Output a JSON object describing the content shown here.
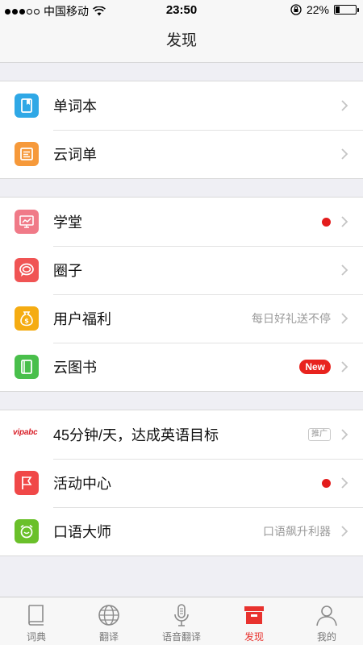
{
  "status_bar": {
    "carrier": "中国移动",
    "time": "23:50",
    "battery": "22%",
    "battery_level": 0.22
  },
  "navbar": {
    "title": "发现"
  },
  "groups": [
    {
      "rows": [
        {
          "label": "单词本",
          "icon": "notebook-icon",
          "color": "#2fa8e6"
        },
        {
          "label": "云词单",
          "icon": "list-icon",
          "color": "#f6993a"
        }
      ]
    },
    {
      "rows": [
        {
          "label": "学堂",
          "icon": "presentation-icon",
          "color": "#f07a88",
          "red_dot": true
        },
        {
          "label": "圈子",
          "icon": "chat-bubble-icon",
          "color": "#f05454"
        },
        {
          "label": "用户福利",
          "icon": "money-bag-icon",
          "color": "#f5ac12",
          "hint": "每日好礼送不停"
        },
        {
          "label": "云图书",
          "icon": "book-icon",
          "color": "#49bf4b",
          "badge": "New"
        }
      ]
    },
    {
      "rows": [
        {
          "label": "45分钟/天，达成英语目标",
          "icon": "vipabc-logo",
          "logo_text": "vipabc",
          "tag": "推广"
        },
        {
          "label": "活动中心",
          "icon": "flag-icon",
          "color": "#f04848",
          "red_dot": true
        },
        {
          "label": "口语大师",
          "icon": "alarm-clock-icon",
          "color": "#6ac02a",
          "hint": "口语飙升利器"
        }
      ]
    }
  ],
  "tabbar": {
    "tabs": [
      {
        "label": "词典",
        "icon": "dictionary-icon",
        "active": false
      },
      {
        "label": "翻译",
        "icon": "globe-icon",
        "active": false
      },
      {
        "label": "语音翻译",
        "icon": "microphone-icon",
        "active": false
      },
      {
        "label": "发现",
        "icon": "discover-box-icon",
        "active": true
      },
      {
        "label": "我的",
        "icon": "user-icon",
        "active": false
      }
    ],
    "active_color": "#e8322e"
  }
}
